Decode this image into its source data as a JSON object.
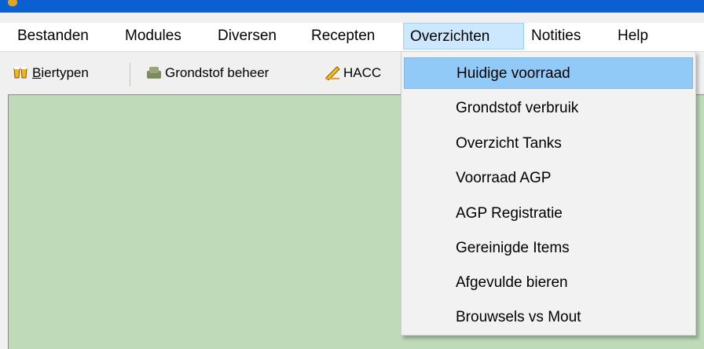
{
  "menubar": {
    "items": [
      {
        "label": "Bestanden"
      },
      {
        "label": "Modules"
      },
      {
        "label": "Diversen"
      },
      {
        "label": "Recepten"
      },
      {
        "label": "Overzichten",
        "active": true
      },
      {
        "label": "Notities"
      },
      {
        "label": "Help"
      }
    ]
  },
  "toolbar": {
    "biertypen_label": "Biertypen",
    "grondstof_label": "Grondstof beheer",
    "hacc_label": "HACC"
  },
  "dropdown": {
    "items": [
      {
        "label": "Huidige voorraad",
        "highlighted": true
      },
      {
        "label": "Grondstof verbruik"
      },
      {
        "label": "Overzicht Tanks"
      },
      {
        "label": "Voorraad AGP"
      },
      {
        "label": "AGP Registratie"
      },
      {
        "label": "Gereinigde Items"
      },
      {
        "label": "Afgevulde bieren"
      },
      {
        "label": "Brouwsels vs Mout"
      }
    ]
  },
  "colors": {
    "titlebar": "#0a5fd1",
    "workspace": "#bedab9",
    "menu_highlight": "#91c9f7",
    "menubar_active": "#cce8ff"
  }
}
